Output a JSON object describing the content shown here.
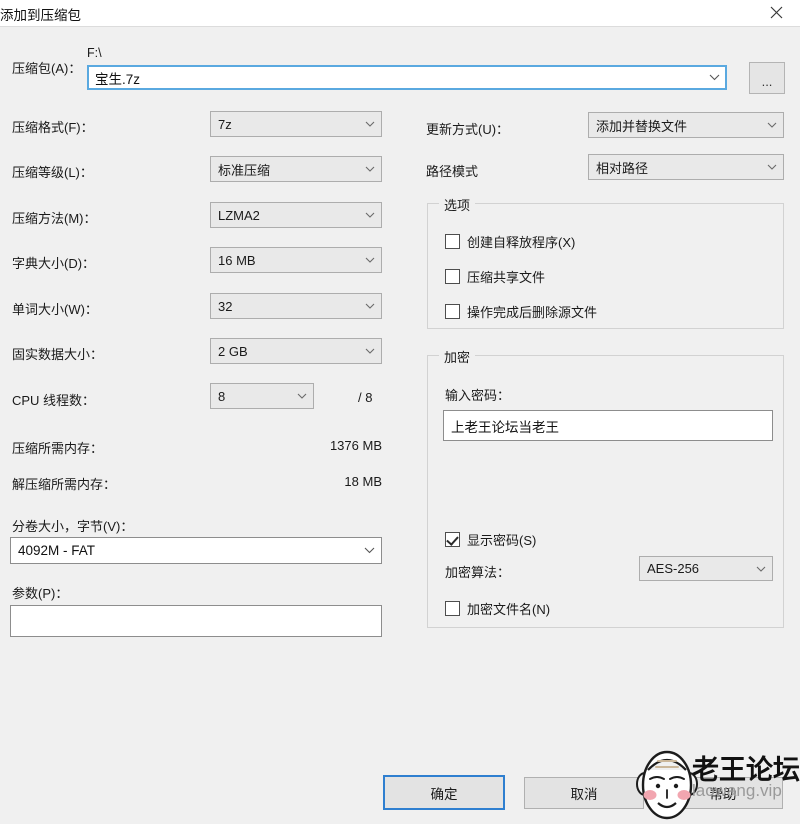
{
  "window": {
    "title": "添加到压缩包",
    "close_icon": "close-icon"
  },
  "archive": {
    "label": "压缩包(A)：",
    "path_prefix": "F:\\",
    "name_value": "宝生.7z",
    "browse_label": "...",
    "dropdown_icon": "chevron-down-icon"
  },
  "left_fields": [
    {
      "label": "压缩格式(F)：",
      "value": "7z",
      "name": "archive-format"
    },
    {
      "label": "压缩等级(L)：",
      "value": "标准压缩",
      "name": "compression-level"
    },
    {
      "label": "压缩方法(M)：",
      "value": "LZMA2",
      "name": "compression-method"
    },
    {
      "label": "字典大小(D)：",
      "value": "16 MB",
      "name": "dictionary-size"
    },
    {
      "label": "单词大小(W)：",
      "value": "32",
      "name": "word-size"
    },
    {
      "label": "固实数据大小：",
      "value": "2 GB",
      "name": "solid-block-size"
    },
    {
      "label": "CPU 线程数：",
      "value": "8",
      "name": "cpu-threads"
    }
  ],
  "cpu_threads_total": "/ 8",
  "memory": {
    "compress_label": "压缩所需内存：",
    "compress_value": "1376 MB",
    "decompress_label": "解压缩所需内存：",
    "decompress_value": "18 MB"
  },
  "split": {
    "label": "分卷大小，字节(V)：",
    "value": "4092M - FAT"
  },
  "parameters": {
    "label": "参数(P)：",
    "value": ""
  },
  "right_fields": [
    {
      "label": "更新方式(U)：",
      "value": "添加并替换文件",
      "name": "update-mode"
    },
    {
      "label": "路径模式",
      "value": "相对路径",
      "name": "path-mode"
    }
  ],
  "options": {
    "title": "选项",
    "items": [
      {
        "label": "创建自释放程序(X)",
        "checked": false,
        "name": "create-sfx"
      },
      {
        "label": "压缩共享文件",
        "checked": false,
        "name": "compress-shared-files"
      },
      {
        "label": "操作完成后删除源文件",
        "checked": false,
        "name": "delete-files-after"
      }
    ]
  },
  "encryption": {
    "title": "加密",
    "password_label": "输入密码：",
    "password_value": "上老王论坛当老王",
    "show_password": {
      "label": "显示密码(S)",
      "checked": true
    },
    "method_label": "加密算法：",
    "method_value": "AES-256",
    "encrypt_filenames": {
      "label": "加密文件名(N)",
      "checked": false
    }
  },
  "buttons": {
    "ok": "确定",
    "cancel": "取消",
    "help": "帮助"
  },
  "watermark": {
    "title": "老王论坛",
    "subtitle": "laowang.vip"
  },
  "colors": {
    "background": "#f0f0f0",
    "accent": "#2f7fd0",
    "field_bg": "#e9e9e9",
    "input_bg": "#ffffff"
  }
}
